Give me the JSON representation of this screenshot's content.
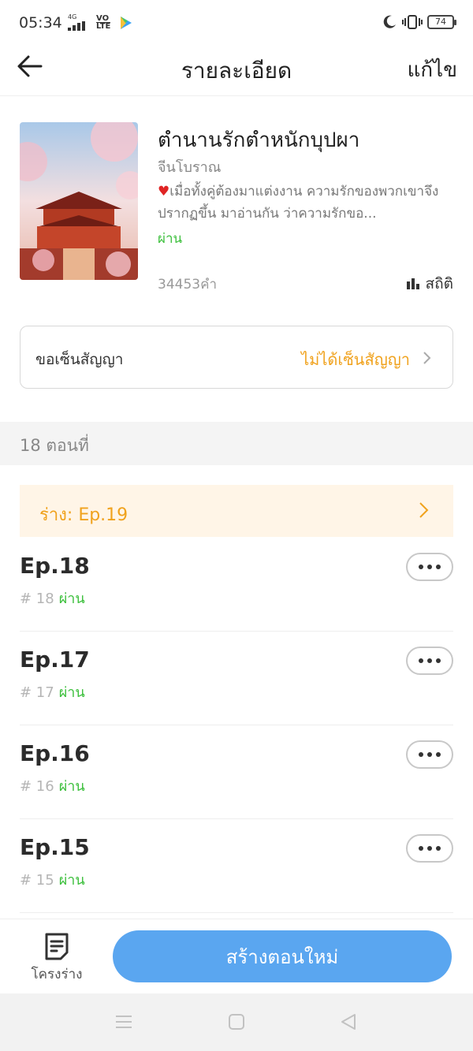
{
  "status_bar": {
    "time": "05:34",
    "network": "4G",
    "volte_top": "VO",
    "volte_bottom": "LTE",
    "battery": "74"
  },
  "header": {
    "title": "รายละเอียด",
    "edit_label": "แก้ไข"
  },
  "book": {
    "title": "ตำนานรักตำหนักบุปผา",
    "genre": "จีนโบราณ",
    "description": "เมื่อทั้งคู่ต้องมาแต่งงาน ความรักของพวกเขาจึงปรากฏขึ้น มาอ่านกัน ว่าความรักขอ...",
    "status": "ผ่าน",
    "word_count": "34453คำ",
    "stats_label": "สถิติ"
  },
  "contract": {
    "label": "ขอเซ็นสัญญา",
    "status": "ไม่ได้เซ็นสัญญา",
    "status_color": "#f0a21d"
  },
  "chapters": {
    "count_label": "18 ตอนที่",
    "draft_label": "ร่าง: Ep.19",
    "items": [
      {
        "title": "Ep.18",
        "number": "# 18",
        "status": "ผ่าน"
      },
      {
        "title": "Ep.17",
        "number": "# 17",
        "status": "ผ่าน"
      },
      {
        "title": "Ep.16",
        "number": "# 16",
        "status": "ผ่าน"
      },
      {
        "title": "Ep.15",
        "number": "# 15",
        "status": "ผ่าน"
      }
    ]
  },
  "bottom_bar": {
    "outline_label": "โครงร่าง",
    "create_label": "สร้างตอนใหม่",
    "accent_color": "#5aa6f0"
  },
  "colors": {
    "approved": "#3bbf3b",
    "draft_bg": "#fff5e7"
  }
}
